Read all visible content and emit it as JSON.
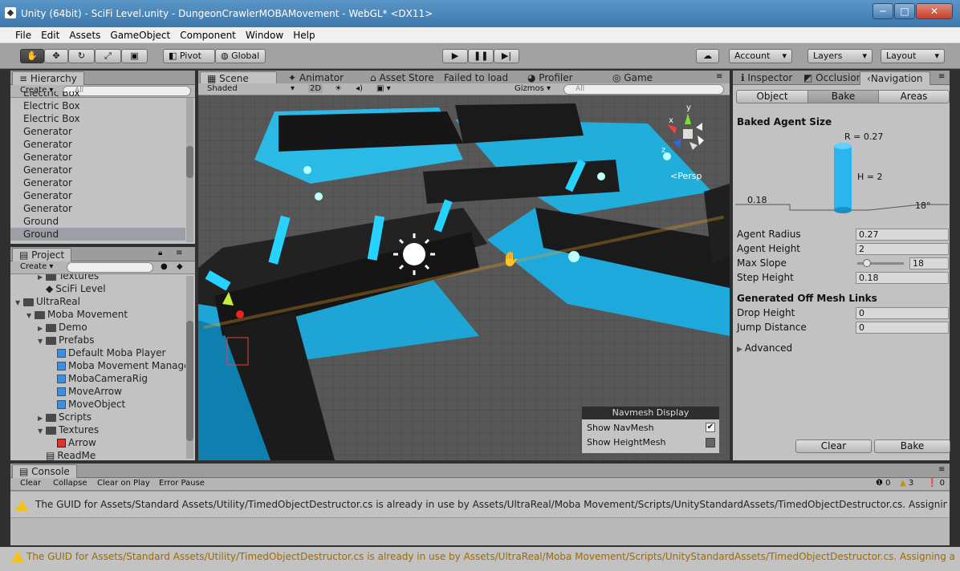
{
  "window": {
    "title": "Unity (64bit) - SciFi Level.unity - DungeonCrawlerMOBAMovement - WebGL* <DX11>",
    "minimize": "─",
    "maximize": "□",
    "close": "✕"
  },
  "menu": [
    "File",
    "Edit",
    "Assets",
    "GameObject",
    "Component",
    "Window",
    "Help"
  ],
  "toolbar": {
    "pivot": "Pivot",
    "global": "Global",
    "account": "Account",
    "layers": "Layers",
    "layout": "Layout"
  },
  "hierarchy": {
    "tab": "Hierarchy",
    "create": "Create",
    "search_placeholder": "All",
    "items": [
      "Electric Box",
      "Electric Box",
      "Electric Box",
      "Generator",
      "Generator",
      "Generator",
      "Generator",
      "Generator",
      "Generator",
      "Generator",
      "Ground",
      "Ground"
    ]
  },
  "project": {
    "tab": "Project",
    "create": "Create",
    "items": [
      {
        "label": "Textures",
        "indent": 2,
        "type": "folder"
      },
      {
        "label": "SciFi Level",
        "indent": 2,
        "type": "unity"
      },
      {
        "label": "UltraReal",
        "indent": 0,
        "type": "folder",
        "open": true
      },
      {
        "label": "Moba Movement",
        "indent": 1,
        "type": "folder",
        "open": true
      },
      {
        "label": "Demo",
        "indent": 2,
        "type": "folder",
        "open": false
      },
      {
        "label": "Prefabs",
        "indent": 2,
        "type": "folder",
        "open": true
      },
      {
        "label": "Default Moba Player",
        "indent": 3,
        "type": "prefab"
      },
      {
        "label": "Moba Movement Manage",
        "indent": 3,
        "type": "prefab"
      },
      {
        "label": "MobaCameraRig",
        "indent": 3,
        "type": "prefab"
      },
      {
        "label": "MoveArrow",
        "indent": 3,
        "type": "prefab"
      },
      {
        "label": "MoveObject",
        "indent": 3,
        "type": "prefab"
      },
      {
        "label": "Scripts",
        "indent": 2,
        "type": "folder",
        "open": false
      },
      {
        "label": "Textures",
        "indent": 2,
        "type": "folder",
        "open": true
      },
      {
        "label": "Arrow",
        "indent": 3,
        "type": "texture"
      },
      {
        "label": "ReadMe",
        "indent": 2,
        "type": "doc"
      }
    ]
  },
  "center_tabs": {
    "scene": "Scene",
    "animator": "Animator",
    "asset_store": "Asset Store",
    "failed": "Failed to load",
    "profiler": "Profiler",
    "game": "Game"
  },
  "scene_bar": {
    "shaded": "Shaded",
    "twod": "2D",
    "gizmos": "Gizmos",
    "search_placeholder": "All"
  },
  "gizmo": {
    "persp": "<Persp",
    "x": "x",
    "y": "y",
    "z": "z"
  },
  "navmesh_display": {
    "title": "Navmesh Display",
    "show_navmesh": "Show NavMesh",
    "show_heightmesh": "Show HeightMesh",
    "navmesh_checked": true,
    "heightmesh_checked": false
  },
  "right_tabs": {
    "inspector": "Inspector",
    "occlusion": "Occlusion",
    "navigation": "Navigation"
  },
  "nav_tabs": {
    "object": "Object",
    "bake": "Bake",
    "areas": "Areas"
  },
  "baked": {
    "title": "Baked Agent Size",
    "r": "R = 0.27",
    "h": "H = 2",
    "step": "0.18",
    "slope": "18°"
  },
  "agent": {
    "radius_label": "Agent Radius",
    "radius": "0.27",
    "height_label": "Agent Height",
    "height": "2",
    "slope_label": "Max Slope",
    "slope": "18",
    "slope_fraction": 0.2,
    "step_label": "Step Height",
    "step": "0.18"
  },
  "offmesh": {
    "title": "Generated Off Mesh Links",
    "drop_label": "Drop Height",
    "drop": "0",
    "jump_label": "Jump Distance",
    "jump": "0",
    "advanced": "Advanced"
  },
  "bake_buttons": {
    "clear": "Clear",
    "bake": "Bake"
  },
  "console": {
    "tab": "Console",
    "clear": "Clear",
    "collapse": "Collapse",
    "clear_on_play": "Clear on Play",
    "error_pause": "Error Pause",
    "count_log": "0",
    "count_warn": "3",
    "count_err": "0",
    "message": "The GUID for Assets/Standard Assets/Utility/TimedObjectDestructor.cs is already in use by Assets/UltraReal/Moba Movement/Scripts/UnityStandardAssets/TimedObjectDestructor.cs. Assigning a ne"
  },
  "status": {
    "message": "The GUID for Assets/Standard Assets/Utility/TimedObjectDestructor.cs is already in use by Assets/UltraReal/Moba Movement/Scripts/UnityStandardAssets/TimedObjectDestructor.cs. Assigning a new gu"
  }
}
